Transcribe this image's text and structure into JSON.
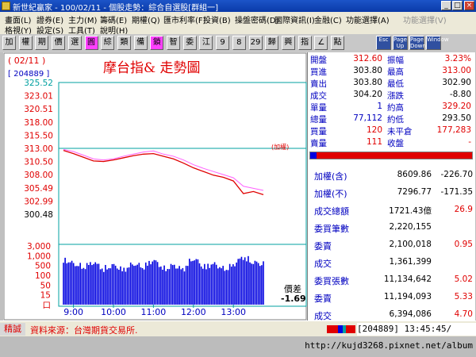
{
  "window": {
    "title": "新世紀贏家 - 100/02/11 - 個股走勢：綜合自選股[群組一]",
    "min": "_",
    "max": "□",
    "close": "×"
  },
  "menu": {
    "row1": [
      "畫面(L)",
      "證券(E)",
      "主力(M)",
      "籌碼(E)",
      "期權(Q)",
      "匯市利率(F)",
      "投資(B)",
      "操盤密碼(D)",
      "國際資訊(I)",
      "金融(C)",
      "功能選擇(A)",
      "功能選擇(V)"
    ],
    "row2": [
      "格視(Y)",
      "設定(S)",
      "工具(T)",
      "說明(H)"
    ]
  },
  "toolbar": {
    "buttons": [
      "加",
      "權",
      "期",
      "價",
      "選",
      "圓",
      "綜",
      "類",
      "備",
      "鎖",
      "智",
      "委",
      "江",
      "9",
      "8",
      "29",
      "歸",
      "興",
      "指",
      "∠",
      "點"
    ],
    "graphic_buttons": [
      "Esc",
      "Page Up",
      "Page Down",
      "Window"
    ]
  },
  "chart": {
    "date": "( 02/11 )",
    "code": "[ 204889 ]",
    "title": "摩台指& 走勢圖",
    "ref_label": "(加權)",
    "price_ticks": [
      "325.52",
      "323.01",
      "320.51",
      "318.00",
      "315.50",
      "313.00",
      "310.50",
      "308.00",
      "305.49",
      "302.99",
      "300.48"
    ],
    "volume_ticks": [
      "3,000",
      "1,000",
      "500",
      "100",
      "50",
      "15",
      "口"
    ],
    "time_ticks": [
      "9:00",
      "10:00",
      "11:00",
      "12:00",
      "13:00"
    ],
    "spread_label": "價差",
    "spread_value": "-1.69",
    "colors": {
      "price": "#e00000",
      "index": "#ff60ff",
      "volume": "#0000e0",
      "reference": "#00a0a0"
    }
  },
  "chart_data": {
    "type": "line",
    "title": "摩台指& 走勢圖",
    "xlabel": "",
    "ylabel": "",
    "x": [
      "8:45",
      "9:00",
      "9:15",
      "9:30",
      "9:45",
      "10:00",
      "10:15",
      "10:30",
      "10:45",
      "11:00",
      "11:15",
      "11:30",
      "11:45",
      "12:00",
      "12:15",
      "12:30",
      "12:45",
      "13:00",
      "13:15",
      "13:30",
      "13:45"
    ],
    "ylim": [
      300.48,
      325.52
    ],
    "reference": 313.0,
    "series": [
      {
        "values": [
          312.6,
          312.0,
          311.3,
          310.6,
          310.5,
          310.8,
          311.2,
          311.6,
          311.9,
          312.0,
          311.5,
          311.0,
          310.2,
          309.3,
          308.6,
          307.9,
          307.5,
          306.8,
          304.4,
          304.8,
          304.2
        ]
      },
      {
        "values": [
          312.8,
          312.4,
          311.7,
          311.0,
          310.8,
          311.0,
          311.5,
          311.9,
          312.3,
          312.5,
          311.9,
          311.5,
          310.8,
          309.9,
          309.2,
          308.6,
          308.0,
          307.4,
          305.8,
          305.4,
          305.0
        ]
      }
    ],
    "volume": {
      "ticks": [
        "3,000",
        "1,000",
        "500",
        "100",
        "50",
        "15"
      ],
      "values": [
        1200,
        800,
        600,
        900,
        500,
        700,
        450,
        800,
        600,
        1100,
        500,
        700,
        450,
        1300,
        600,
        800,
        500,
        700,
        1500,
        900,
        800
      ]
    }
  },
  "quote": {
    "rows": [
      {
        "l1": "開盤",
        "v1": "312.60",
        "l2": "振幅",
        "v2": "3.23%"
      },
      {
        "l1": "買進",
        "v1": "303.80",
        "l2": "最高",
        "v2": "313.00"
      },
      {
        "l1": "賣出",
        "v1": "303.80",
        "l2": "最低",
        "v2": "302.90"
      },
      {
        "l1": "成交",
        "v1": "304.20",
        "l2": "漲跌",
        "v2": "-8.80"
      },
      {
        "l1": "單量",
        "v1": "1",
        "l2": "約高",
        "v2": "329.20"
      },
      {
        "l1": "總量",
        "v1": "77,112",
        "l2": "約低",
        "v2": "293.50"
      },
      {
        "l1": "買量",
        "v1": "120",
        "l2": "未平倉",
        "v2": "177,283"
      },
      {
        "l1": "賣量",
        "v1": "111",
        "l2": "收盤",
        "v2": "-"
      }
    ]
  },
  "market": {
    "rows": [
      {
        "label": "加權(含)",
        "v1": "8609.86",
        "v2": "-226.70"
      },
      {
        "label": "加權(不)",
        "v1": "7296.77",
        "v2": "-171.35"
      },
      {
        "label": "成交總額",
        "v1": "1721.43億",
        "v2": "26.9"
      },
      {
        "label": "委買筆數",
        "v1": "2,220,155",
        "v2": ""
      },
      {
        "label": "委賣",
        "v1": "2,100,018",
        "v2": "0.95"
      },
      {
        "label": "成交",
        "v1": "1,361,399",
        "v2": ""
      },
      {
        "label": "委買張數",
        "v1": "11,134,642",
        "v2": "5.02"
      },
      {
        "label": "委賣",
        "v1": "11,194,093",
        "v2": "5.33"
      },
      {
        "label": "成交",
        "v1": "6,394,086",
        "v2": "4.70"
      }
    ]
  },
  "status": {
    "mode": "精誠",
    "source": "資料來源：台灣期貨交易所.",
    "code": "[204889]",
    "time": "13:45:45/"
  },
  "footer": {
    "url": "http://kujd3268.pixnet.net/album"
  }
}
